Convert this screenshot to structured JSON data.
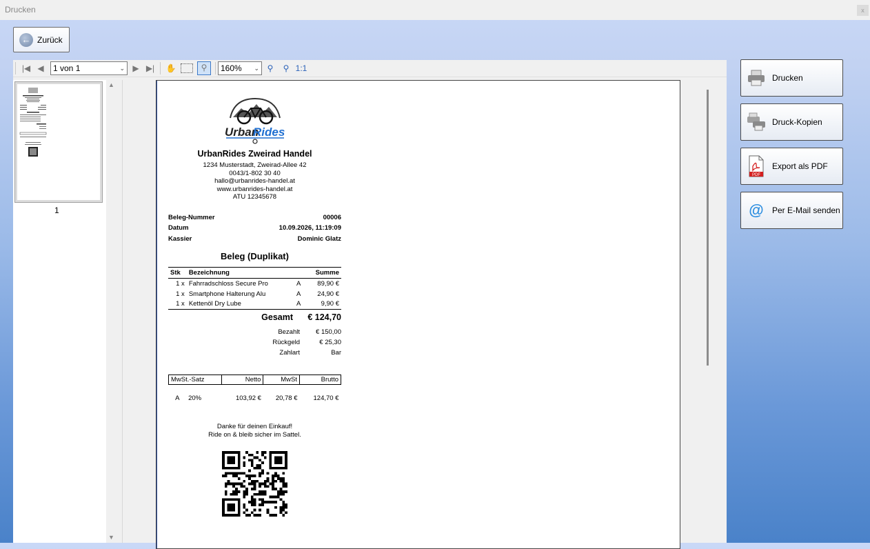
{
  "window": {
    "title": "Drucken",
    "close_label": "x"
  },
  "back_button": {
    "label": "Zurück"
  },
  "toolbar": {
    "page_select": "1 von 1",
    "zoom_select": "160%",
    "zoom_reset": "1:1"
  },
  "thumbnails": {
    "page_number": "1"
  },
  "actions": {
    "print": "Drucken",
    "print_copies": "Druck-Kopien",
    "export_pdf": "Export als PDF",
    "email": "Per E-Mail senden",
    "pdf_badge": "PDF"
  },
  "receipt": {
    "shop_name": "UrbanRides Zweirad Handel",
    "address_line": "1234 Musterstadt, Zweirad-Allee 42",
    "phone": "0043/1-802 30 40",
    "email": "hallo@urbanrides-handel.at",
    "website": "www.urbanrides-handel.at",
    "vat_id": "ATU 12345678",
    "meta": [
      {
        "label": "Beleg-Nummer",
        "value": "00006"
      },
      {
        "label": "Datum",
        "value": "10.09.2026, 11:19:09"
      },
      {
        "label": "Kassier",
        "value": "Dominic Glatz"
      }
    ],
    "title": "Beleg (Duplikat)",
    "item_headers": {
      "qty": "Stk",
      "desc": "Bezeichnung",
      "sum": "Summe"
    },
    "items": [
      {
        "qty": "1 x",
        "desc": "Fahrradschloss Secure Pro",
        "tax": "A",
        "sum": "89,90 €"
      },
      {
        "qty": "1 x",
        "desc": "Smartphone Halterung Alu",
        "tax": "A",
        "sum": "24,90 €"
      },
      {
        "qty": "1 x",
        "desc": "Kettenöl Dry Lube",
        "tax": "A",
        "sum": "9,90 €"
      }
    ],
    "total_label": "Gesamt",
    "total_value": "€ 124,70",
    "payments": [
      {
        "label": "Bezahlt",
        "value": "€ 150,00"
      },
      {
        "label": "Rückgeld",
        "value": "€ 25,30"
      },
      {
        "label": "Zahlart",
        "value": "Bar"
      }
    ],
    "tax_headers": {
      "rate": "MwSt.-Satz",
      "net": "Netto",
      "vat": "MwSt",
      "gross": "Brutto"
    },
    "tax_row": {
      "code": "A",
      "rate": "20%",
      "net": "103,92 €",
      "vat": "20,78 €",
      "gross": "124,70 €"
    },
    "thanks_1": "Danke für deinen Einkauf!",
    "thanks_2": "Ride on & bleib sicher im Sattel.",
    "logo_text_1": "Urban",
    "logo_text_2": "Rides"
  }
}
